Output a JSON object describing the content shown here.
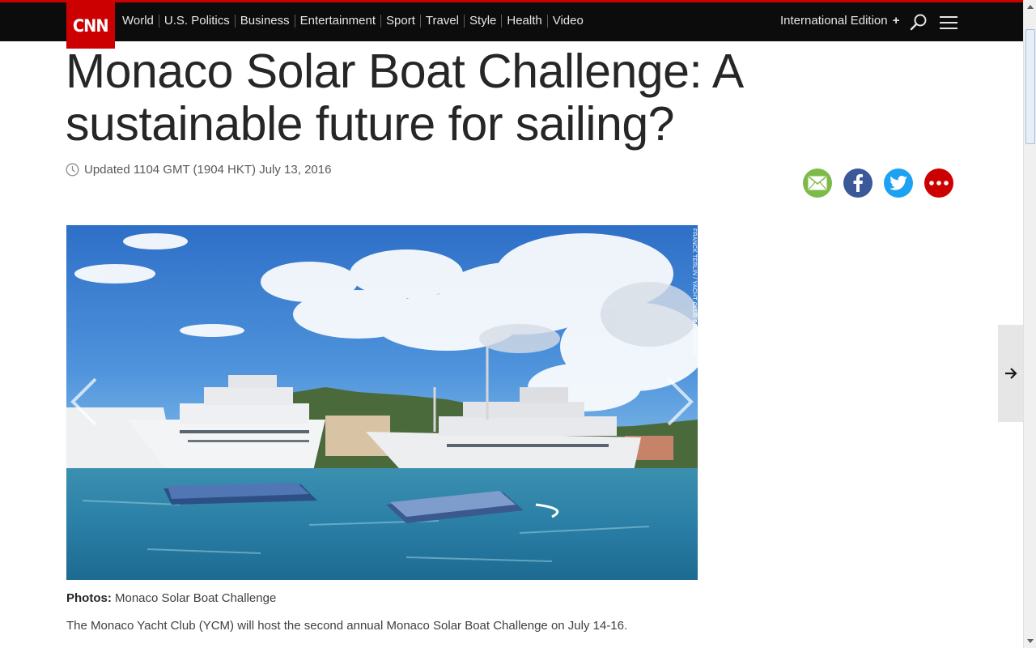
{
  "brand": {
    "logo_text": "CNN",
    "accent": "#cc0000"
  },
  "nav": {
    "items": [
      "World",
      "U.S. Politics",
      "Business",
      "Entertainment",
      "Sport",
      "Travel",
      "Style",
      "Health",
      "Video"
    ],
    "edition_label": "International Edition",
    "edition_plus": "+",
    "search_icon": "search-icon",
    "menu_icon": "hamburger-menu-icon"
  },
  "article": {
    "headline": "Monaco Solar Boat Challenge: A sustainable future for sailing?",
    "updated": "Updated 1104 GMT (1904 HKT) July 13, 2016",
    "share": [
      {
        "name": "email",
        "icon": "envelope-icon",
        "color": "#7dbb49"
      },
      {
        "name": "facebook",
        "icon": "facebook-icon",
        "color": "#3b5998"
      },
      {
        "name": "twitter",
        "icon": "twitter-icon",
        "color": "#1da1f2"
      },
      {
        "name": "more",
        "icon": "more-dots-icon",
        "color": "#cc0000"
      }
    ],
    "photo_credit": "FRANCK TERLIN / YACHT CLUB DE MONACO",
    "caption_label": "Photos:",
    "caption_text": "Monaco Solar Boat Challenge",
    "body_first": "The Monaco Yacht Club (YCM) will host the second annual Monaco Solar Boat Challenge on July 14-16."
  },
  "gallery": {
    "prev_icon": "chevron-left-icon",
    "next_icon": "chevron-right-icon"
  },
  "next_story_icon": "arrow-right-icon"
}
